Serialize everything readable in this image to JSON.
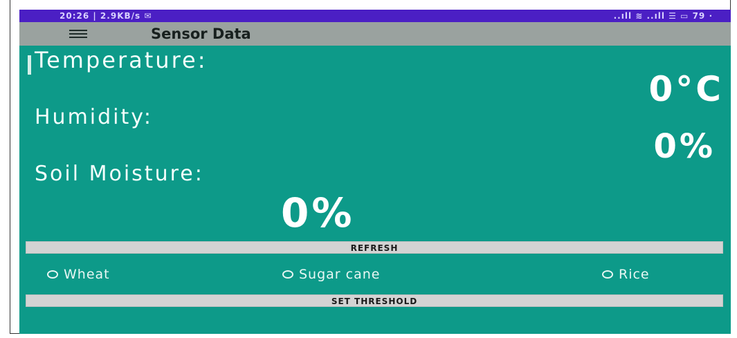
{
  "status_bar": {
    "left_text": "20:26 | 2.9KB/s ✉",
    "right_text": "..ıll ≋ ..ıll ☰ ▭ 79 ∙"
  },
  "toolbar": {
    "title": "Sensor Data"
  },
  "sensors": {
    "temperature_label": "Temperature:",
    "temperature_value": "0°C",
    "humidity_label": "Humidity:",
    "humidity_value": "0%",
    "soil_label": "Soil Moisture:",
    "soil_value": "0%"
  },
  "buttons": {
    "refresh": "REFRESH",
    "set_threshold": "SET THRESHOLD"
  },
  "crops": {
    "options": [
      "Wheat",
      "Sugar cane",
      "Rice"
    ]
  },
  "colors": {
    "status_bar": "#4b1fc4",
    "toolbar": "#9aa29f",
    "content_bg": "#0d9a89"
  }
}
